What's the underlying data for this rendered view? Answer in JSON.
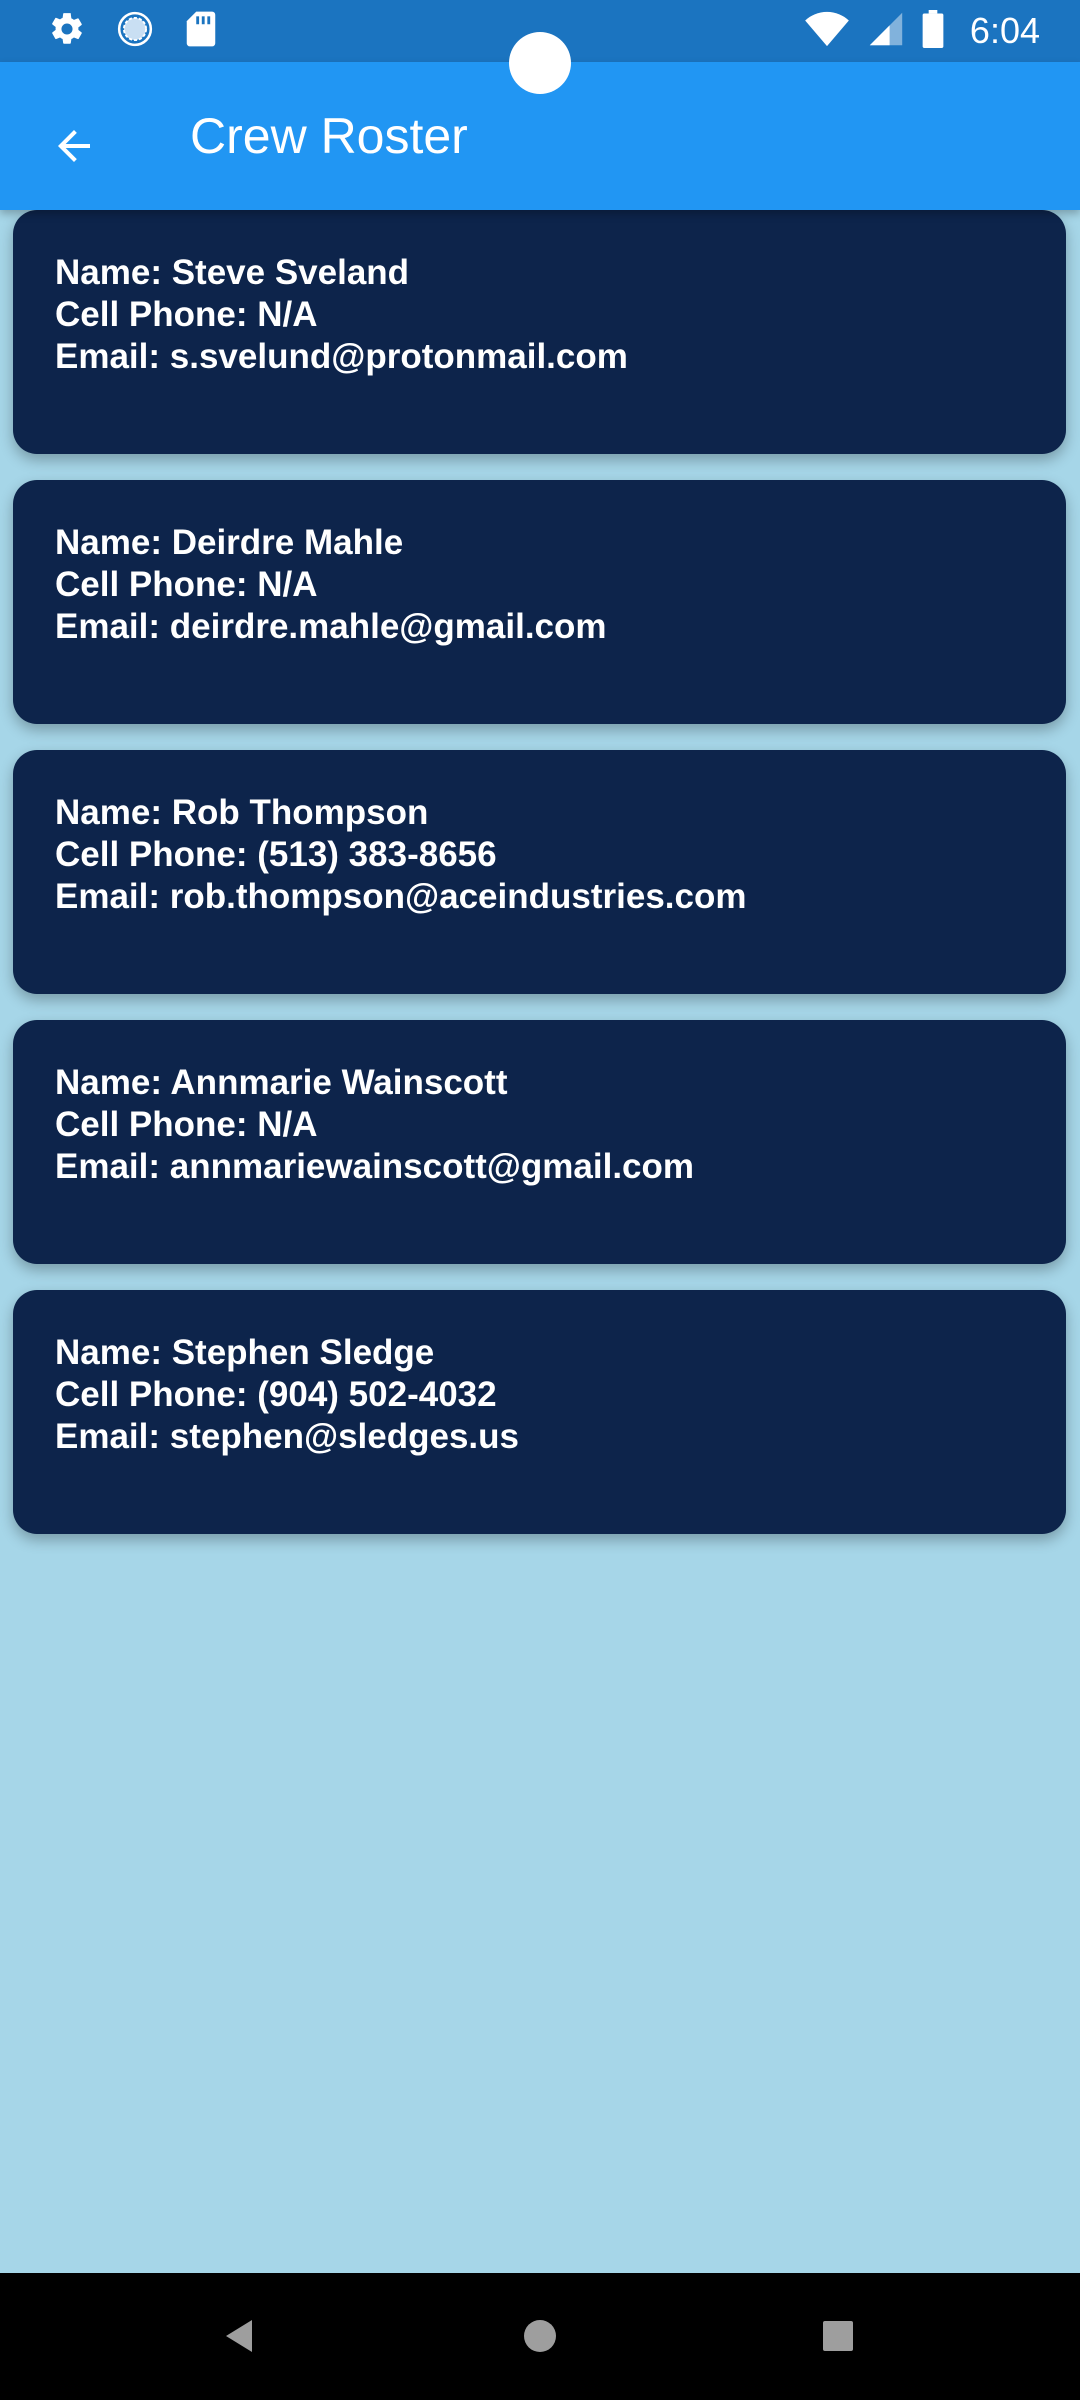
{
  "status_bar": {
    "time": "6:04",
    "left_icons": [
      "settings-icon",
      "sync-icon",
      "sd-card-icon"
    ],
    "right_icons": [
      "wifi-icon",
      "signal-icon",
      "battery-icon"
    ]
  },
  "app_bar": {
    "title": "Crew Roster",
    "back_icon": "arrow-back-icon"
  },
  "crew": [
    {
      "name": "Name: Steve Sveland",
      "phone": "Cell Phone: N/A",
      "email": "Email: s.svelund@protonmail.com"
    },
    {
      "name": "Name: Deirdre Mahle",
      "phone": "Cell Phone: N/A",
      "email": "Email: deirdre.mahle@gmail.com"
    },
    {
      "name": "Name: Rob Thompson",
      "phone": "Cell Phone: (513) 383-8656",
      "email": "Email: rob.thompson@aceindustries.com"
    },
    {
      "name": "Name: Annmarie Wainscott",
      "phone": "Cell Phone: N/A",
      "email": "Email: annmariewainscott@gmail.com"
    },
    {
      "name": "Name: Stephen Sledge",
      "phone": "Cell Phone: (904) 502-4032",
      "email": "Email: stephen@sledges.us"
    }
  ],
  "nav_bar": {
    "buttons": [
      "back-triangle-icon",
      "home-circle-icon",
      "recents-square-icon"
    ]
  },
  "colors": {
    "status_bar": "#1b74c0",
    "app_bar": "#2196f3",
    "background": "#a6d6e8",
    "card": "#0d244b",
    "text": "#ffffff"
  }
}
